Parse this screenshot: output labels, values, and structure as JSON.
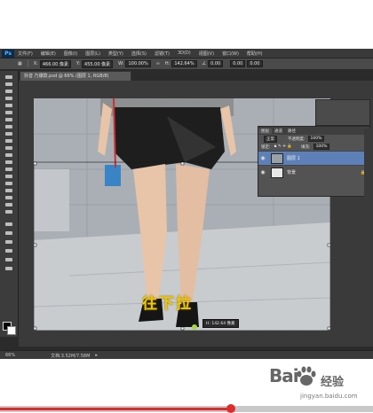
{
  "menubar": {
    "logo": "Ps",
    "items": [
      "文件(F)",
      "编辑(E)",
      "图像(I)",
      "图层(L)",
      "类型(Y)",
      "选择(S)",
      "滤镜(T)",
      "3D(D)",
      "视图(V)",
      "窗口(W)",
      "帮助(H)"
    ]
  },
  "optionsbar": {
    "x_label": "X:",
    "x_value": "466.00 像素",
    "y_label": "Y:",
    "y_value": "455.00 像素",
    "w_label": "W:",
    "w_value": "100.00%",
    "h_label": "H:",
    "h_value": "142.64%",
    "angle_value": "0.00",
    "h_skew_value": "0.00",
    "v_skew_value": "0.00"
  },
  "document": {
    "tab_title": "抖音 乃爆款.psd @ 66% (图层 1, RGB/8)"
  },
  "layers_panel": {
    "tabs": [
      "图层",
      "通道",
      "路径"
    ],
    "blend_mode": "正常",
    "opacity_label": "不透明度:",
    "opacity_value": "100%",
    "lock_label": "锁定:",
    "fill_label": "填充:",
    "fill_value": "100%",
    "layers": [
      {
        "name": "图层 1",
        "selected": true
      },
      {
        "name": "背景",
        "selected": false
      }
    ]
  },
  "canvas": {
    "caption": "往下拉",
    "transform_tooltip": "H: 142.64 像素"
  },
  "status_bar": {
    "zoom": "66%",
    "doc_info": "文档:3.52M/7.58M"
  },
  "watermark": {
    "logo": "Bai",
    "cn": "经验",
    "url": "jingyan.baidu.com"
  },
  "video": {
    "progress": 0.62
  }
}
